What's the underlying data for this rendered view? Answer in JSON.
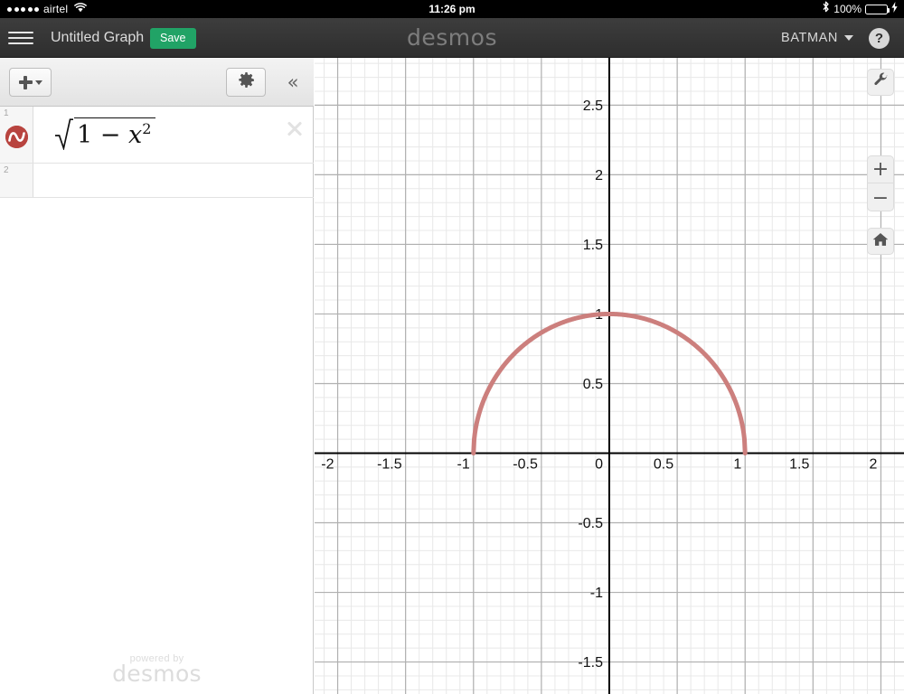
{
  "status_bar": {
    "signal_dots": 5,
    "carrier": "airtel",
    "wifi_icon": "wifi-icon",
    "time": "11:26 pm",
    "bluetooth_icon": "bluetooth-icon",
    "battery_percent": "100%",
    "battery_level": 100,
    "charging_icon": "lightning-bolt-icon",
    "battery_color": "#4cd964",
    "background": "#000000"
  },
  "header": {
    "menu_icon": "hamburger-menu-icon",
    "graph_title": "Untitled Graph",
    "save_label": "Save",
    "save_color": "#21a366",
    "logo_text": "desmos",
    "account_name": "BATMAN",
    "account_caret_icon": "chevron-down-icon",
    "help_label": "?",
    "background": "#2e2e2e"
  },
  "expression_panel": {
    "toolbar": {
      "add_icon": "plus-icon",
      "add_caret_icon": "caret-down-icon",
      "settings_icon": "gear-icon",
      "collapse_icon": "double-chevron-left-icon",
      "collapse_label": "«"
    },
    "rows": [
      {
        "index": "1",
        "expression_latex": "\\sqrt{1-x^2}",
        "expression_plain": "sqrt(1 - x^2)",
        "radicand_left": "1 − ",
        "radicand_var": "x",
        "radicand_exponent": "2",
        "color": "#b8443f",
        "swatch_icon": "curve-color-swatch-icon",
        "delete_icon": "close-x-icon"
      },
      {
        "index": "2",
        "expression_latex": "",
        "expression_plain": ""
      }
    ],
    "watermark_powered": "powered by",
    "watermark_name": "desmos"
  },
  "graph_controls": {
    "wrench_icon": "wrench-icon",
    "zoom_in_label": "+",
    "zoom_in_icon": "plus-icon",
    "zoom_out_label": "−",
    "zoom_out_icon": "minus-icon",
    "home_icon": "home-icon"
  },
  "chart_data": {
    "type": "line",
    "title": "",
    "xlabel": "",
    "ylabel": "",
    "xlim": [
      -2.17,
      2.17
    ],
    "ylim": [
      -1.73,
      2.84
    ],
    "x_ticks": [
      -2,
      -1.5,
      -1,
      -0.5,
      0,
      0.5,
      1,
      1.5,
      2
    ],
    "x_tick_labels": [
      "-2",
      "-1.5",
      "-1",
      "-0.5",
      "0",
      "0.5",
      "1",
      "1.5",
      "2"
    ],
    "y_ticks": [
      2.5,
      2,
      1.5,
      1,
      0.5,
      -0.5,
      -1,
      -1.5
    ],
    "y_tick_labels": [
      "2.5",
      "2",
      "1.5",
      "1",
      "0.5",
      "-0.5",
      "-1",
      "-1.5"
    ],
    "major_grid_step": 0.5,
    "minor_grid_step": 0.1,
    "grid": true,
    "grid_major_color": "#b0b0b0",
    "grid_minor_color": "#e8e8e8",
    "axis_color": "#000000",
    "legend": "none",
    "series": [
      {
        "name": "sqrt(1 - x^2)",
        "color": "#cc7f7d",
        "line_width": 5,
        "domain": [
          -1,
          1
        ],
        "x": [
          -1,
          -0.95,
          -0.9,
          -0.8,
          -0.7,
          -0.6,
          -0.5,
          -0.4,
          -0.3,
          -0.2,
          -0.1,
          0,
          0.1,
          0.2,
          0.3,
          0.4,
          0.5,
          0.6,
          0.7,
          0.8,
          0.9,
          0.95,
          1
        ],
        "values": [
          0,
          0.3122,
          0.4359,
          0.6,
          0.7141,
          0.8,
          0.866,
          0.9165,
          0.9539,
          0.9798,
          0.995,
          1,
          0.995,
          0.9798,
          0.9539,
          0.9165,
          0.866,
          0.8,
          0.7141,
          0.6,
          0.4359,
          0.3122,
          0
        ]
      }
    ]
  }
}
